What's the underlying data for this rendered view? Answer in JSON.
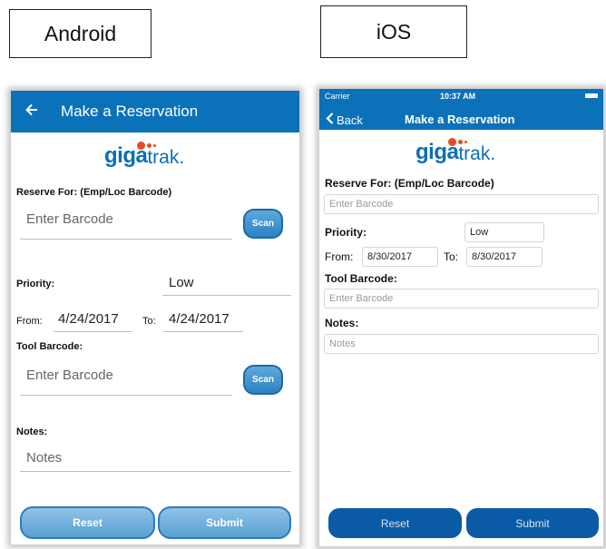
{
  "labels": {
    "android": "Android",
    "ios": "iOS"
  },
  "colors": {
    "app_bar": "#0b72b9",
    "logo_blue": "#0b6fb5",
    "logo_orange": "#e94a28",
    "ios_button": "#0b5aa5"
  },
  "logo": {
    "bold": "giga",
    "regular": "trak."
  },
  "android": {
    "back_icon": "arrow-left-icon",
    "title": "Make a Reservation",
    "reserve_for_label": "Reserve For: (Emp/Loc Barcode)",
    "reserve_for_placeholder": "Enter Barcode",
    "scan_label": "Scan",
    "priority_label": "Priority:",
    "priority_value": "Low",
    "from_label": "From:",
    "from_value": "4/24/2017",
    "to_label": "To:",
    "to_value": "4/24/2017",
    "tool_barcode_label": "Tool Barcode:",
    "tool_barcode_placeholder": "Enter Barcode",
    "notes_label": "Notes:",
    "notes_placeholder": "Notes",
    "reset_label": "Reset",
    "submit_label": "Submit"
  },
  "ios": {
    "carrier": "Carrier",
    "time": "10:37 AM",
    "back_label": "Back",
    "title": "Make a Reservation",
    "reserve_for_label": "Reserve For: (Emp/Loc Barcode)",
    "reserve_for_placeholder": "Enter Barcode",
    "priority_label": "Priority:",
    "priority_value": "Low",
    "from_label": "From:",
    "from_value": "8/30/2017",
    "to_label": "To:",
    "to_value": "8/30/2017",
    "tool_barcode_label": "Tool Barcode:",
    "tool_barcode_placeholder": "Enter Barcode",
    "notes_label": "Notes:",
    "notes_placeholder": "Notes",
    "reset_label": "Reset",
    "submit_label": "Submit"
  }
}
